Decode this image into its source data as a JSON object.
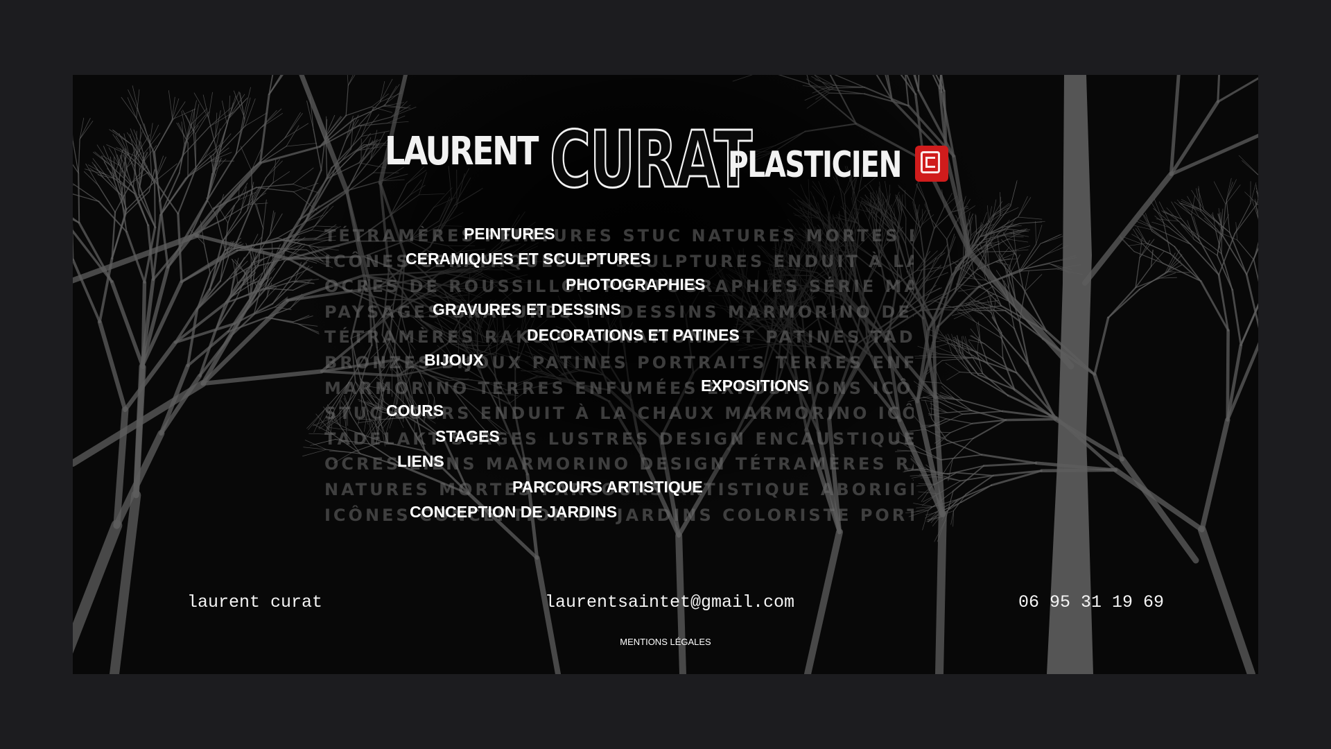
{
  "site": {
    "logo": {
      "first": "LAURENT",
      "last": "CURAT",
      "suffix": "PLASTICIEN",
      "mark_color": "#d01c1c"
    }
  },
  "background_words": [
    "TÉTRAMÈRES PEINTURES STUC NATURES MORTES RAKU",
    "ICÔNES CERAMIQUES ET SCULPTURES ENDUIT À LA CHAUX",
    "OCRES DE ROUSSILLON PHOTOGRAPHIES SÉRIE MAROCAINE",
    "PAYSAGES GRAVURES ET DESSINS MARMORINO DESIGN RAKU",
    "TÉTRAMÈRES RAKU DECORATIONS ET PATINES TADELAKT STUC",
    "BRONZES BIJOUX PATINES PORTRAITS TERRES ENFUMÉES",
    "MARMORINO TERRES ENFUMÉES EXPOSITIONS ICÔNES",
    "STUC COURS ENDUIT À LA CHAUX MARMORINO ICÔNES",
    "TADELAKT STAGES LUSTRES DESIGN ENCAUSTIQUES ICÔNES",
    "OCRES LIENS MARMORINO DESIGN TÉTRAMÈRES RAKU",
    "NATURES MORTES PARCOURS ARTISTIQUE ABORIGÈNE OCRES",
    "ICÔNES CONCEPTION DE JARDINS COLORISTE PORTRAITS STUC"
  ],
  "menu": {
    "peintures": "PEINTURES",
    "ceramiques": "CERAMIQUES ET SCULPTURES",
    "photographies": "PHOTOGRAPHIES",
    "gravures": "GRAVURES ET DESSINS",
    "decorations": "DECORATIONS ET PATINES",
    "bijoux": "BIJOUX",
    "expositions": "EXPOSITIONS",
    "cours": "COURS",
    "stages": "STAGES",
    "liens": "LIENS",
    "parcours": "PARCOURS ARTISTIQUE",
    "jardins": "CONCEPTION DE JARDINS"
  },
  "footer": {
    "name": "laurent curat",
    "email": "laurentsaintet@gmail.com",
    "phone": "06 95 31 19 69",
    "legal": "MENTIONS LÉGALES"
  },
  "colors": {
    "page_bg": "#1c1c1f",
    "tree_gray": "#5e5e5e",
    "text": "#ffffff"
  }
}
